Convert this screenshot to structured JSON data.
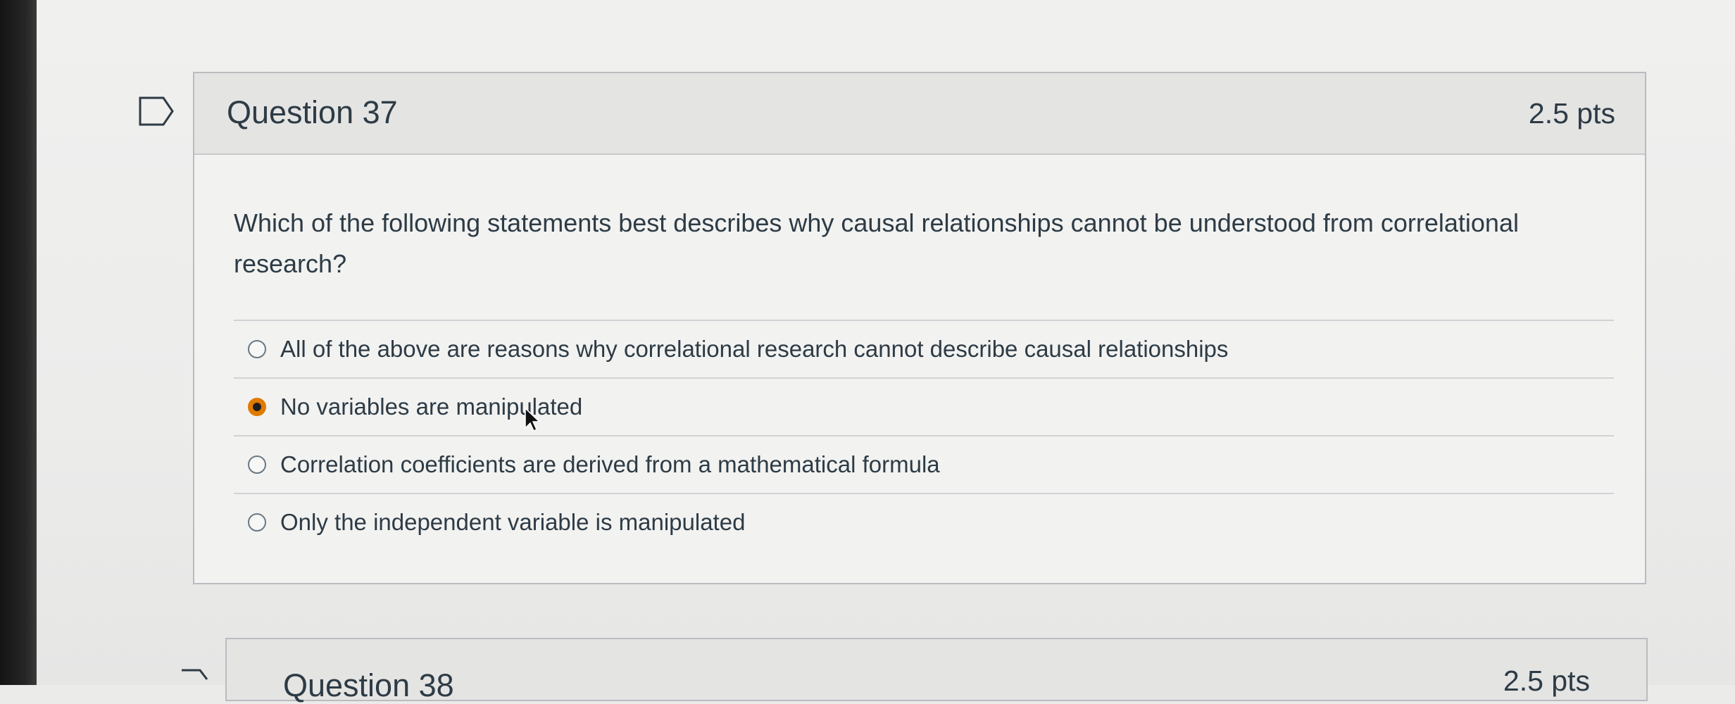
{
  "question": {
    "title": "Question 37",
    "points": "2.5 pts",
    "text": "Which of the following statements best describes why causal relationships cannot be understood from correlational research?",
    "answers": [
      {
        "label": "All of the above are reasons why correlational research cannot describe causal relationships",
        "selected": false
      },
      {
        "label": "No variables are manipulated",
        "selected": true
      },
      {
        "label": "Correlation coefficients are derived from a mathematical formula",
        "selected": false
      },
      {
        "label": "Only the independent variable is manipulated",
        "selected": false
      }
    ]
  },
  "next_question": {
    "title": "Question 38",
    "points": "2.5 pts"
  },
  "colors": {
    "selected_radio_ring": "#e07b00",
    "text": "#2d3b45",
    "border": "#b9bcbf"
  },
  "icons": {
    "flag": "flag-icon",
    "cursor": "cursor-icon"
  }
}
